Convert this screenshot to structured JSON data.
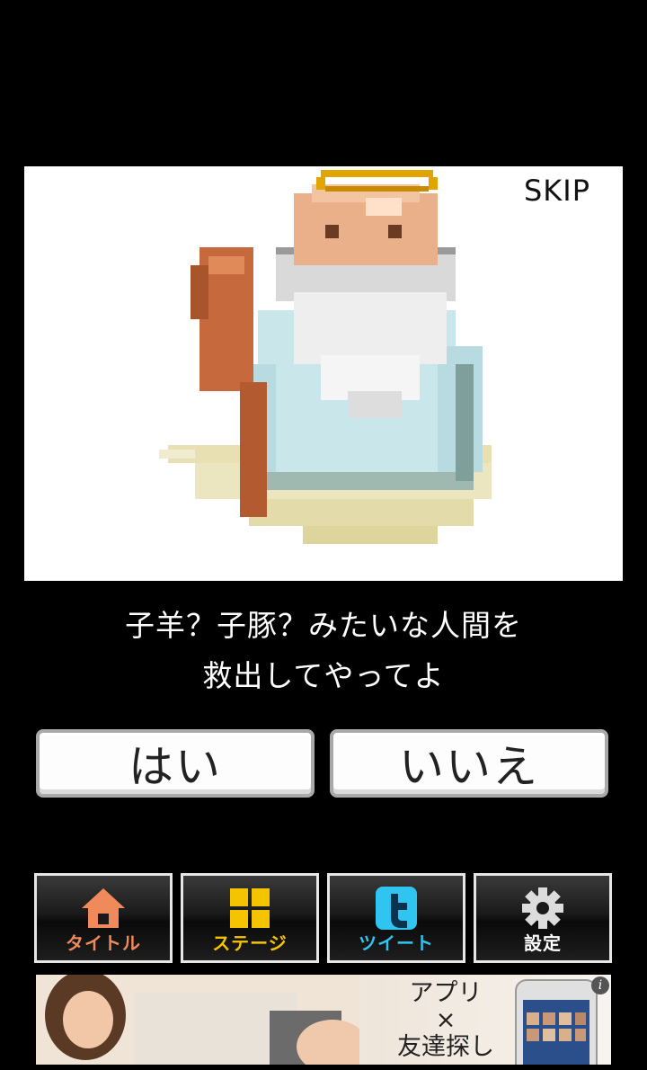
{
  "scene": {
    "skip_label": "SKIP",
    "character": "pixel-god-sprite"
  },
  "dialog": {
    "line1": "子羊？子豚？みたいな人間を",
    "line2": "救出してやってよ"
  },
  "choices": {
    "yes_label": "はい",
    "no_label": "いいえ"
  },
  "toolbar": {
    "items": [
      {
        "label": "タイトル",
        "icon": "home-icon",
        "color": "#f08a5b"
      },
      {
        "label": "ステージ",
        "icon": "grid-icon",
        "color": "#f5c400"
      },
      {
        "label": "ツイート",
        "icon": "twitter-icon",
        "color": "#2fc5f0"
      },
      {
        "label": "設定",
        "icon": "gear-icon",
        "color": "#ffffff"
      }
    ]
  },
  "ad": {
    "line1": "アプリ",
    "line2": "×",
    "line3": "友達探し",
    "info": "i"
  }
}
